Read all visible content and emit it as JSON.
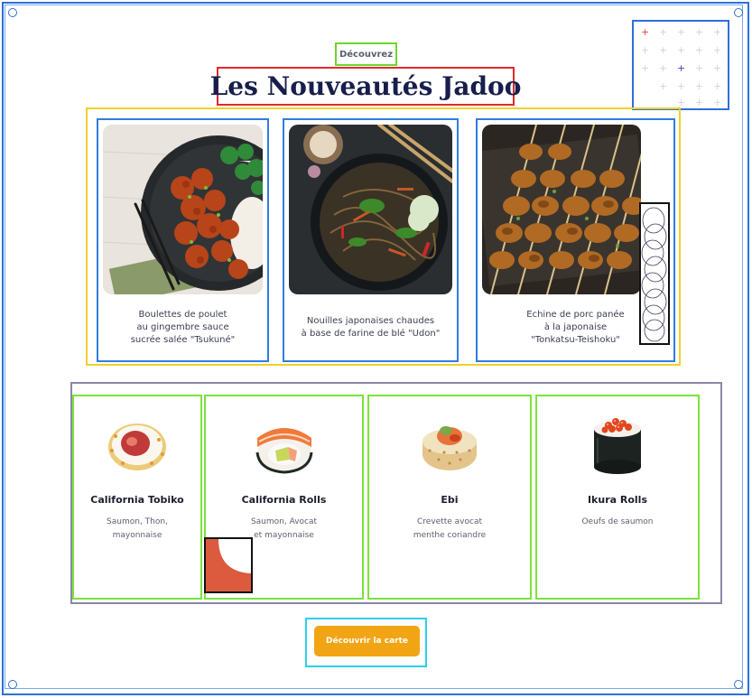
{
  "header": {
    "eyebrow": "Découvrez",
    "title": "Les Nouveautés Jadoo"
  },
  "featured": [
    {
      "caption": "Boulettes de poulet\nau gingembre sauce\nsucrée salée \"Tsukuné\"",
      "image": "chicken-meatballs-bowl-photo"
    },
    {
      "caption": "Nouilles japonaises chaudes\nà base de farine de blé \"Udon\"",
      "image": "udon-noodles-pan-photo"
    },
    {
      "caption": "Echine de porc panée\nà la japonaise\n\"Tonkatsu-Teishoku\"",
      "image": "pork-skewers-photo"
    }
  ],
  "menu": [
    {
      "name": "California Tobiko",
      "desc": "Saumon, Thon,\nmayonnaise",
      "image": "tobiko-roll-photo"
    },
    {
      "name": "California Rolls",
      "desc": "Saumon, Avocat\net mayonnaise",
      "image": "california-roll-photo"
    },
    {
      "name": "Ebi",
      "desc": "Crevette avocat\nmenthe coriandre",
      "image": "ebi-roll-photo"
    },
    {
      "name": "Ikura Rolls",
      "desc": "Oeufs de saumon",
      "image": "ikura-roll-photo"
    }
  ],
  "cta": {
    "label": "Découvrir la carte"
  },
  "colors": {
    "accent": "#f2a514",
    "title": "#181e4b",
    "highlight_plus_red": "#e8452f",
    "highlight_plus_blue": "#3b3ec7"
  }
}
